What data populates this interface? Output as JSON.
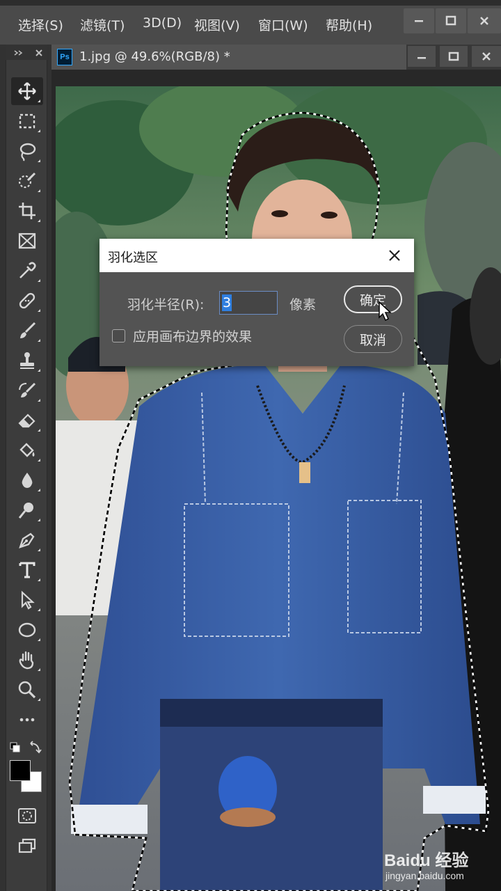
{
  "menubar": {
    "items": [
      "选择(S)",
      "滤镜(T)",
      "3D(D)",
      "视图(V)",
      "窗口(W)",
      "帮助(H)"
    ]
  },
  "document": {
    "app_icon": "Ps",
    "tab_title": "1.jpg @ 49.6%(RGB/8) *"
  },
  "toolbar": {
    "tools": [
      "move-tool-icon",
      "rectangular-marquee-icon",
      "lasso-icon",
      "quick-selection-icon",
      "crop-icon",
      "frame-icon",
      "eyedropper-icon",
      "healing-brush-icon",
      "brush-icon",
      "clone-stamp-icon",
      "history-brush-icon",
      "eraser-icon",
      "paint-bucket-icon",
      "blur-icon",
      "dodge-icon",
      "pen-icon",
      "type-icon",
      "path-selection-icon",
      "ellipse-icon",
      "hand-icon",
      "zoom-icon",
      "more-tools-icon"
    ],
    "active_tool": "move-tool-icon",
    "foreground_color": "#000000",
    "background_color": "#ffffff"
  },
  "dialog": {
    "title": "羽化选区",
    "radius_label": "羽化半径(R):",
    "radius_value": "3",
    "unit": "像素",
    "checkbox_label": "应用画布边界的效果",
    "checkbox_checked": false,
    "ok_label": "确定",
    "cancel_label": "取消"
  },
  "watermark": {
    "line1": "Baidu 经验",
    "line2": "jingyan.baidu.com"
  }
}
